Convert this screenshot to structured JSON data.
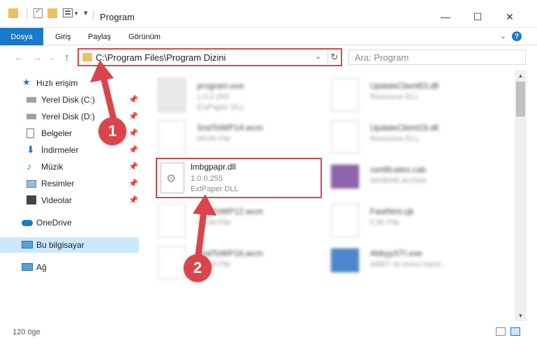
{
  "window": {
    "title": "Program",
    "minimize_glyph": "—",
    "maximize_glyph": "☐",
    "close_glyph": "✕"
  },
  "ribbon": {
    "tabs": [
      "Dosya",
      "Giriş",
      "Paylaş",
      "Görünüm"
    ],
    "expand_glyph": "⌄",
    "help_glyph": "?"
  },
  "address": {
    "path": "C:\\Program Files\\Program Dizini",
    "dropdown_glyph": "⌄",
    "refresh_glyph": "↻"
  },
  "search": {
    "placeholder": "Ara: Program"
  },
  "nav": {
    "back_glyph": "←",
    "forward_glyph": "→",
    "recent_glyph": "⌄",
    "up_glyph": "↑",
    "items": [
      {
        "label": "Hızlı erişim",
        "icon": "star-icon"
      },
      {
        "label": "Yerel Disk (C:)",
        "icon": "drive-icon",
        "pinned": true
      },
      {
        "label": "Yerel Disk (D:)",
        "icon": "drive-icon",
        "pinned": true
      },
      {
        "label": "Belgeler",
        "icon": "documents-icon",
        "pinned": true
      },
      {
        "label": "İndirmeler",
        "icon": "downloads-icon",
        "pinned": true
      },
      {
        "label": "Müzik",
        "icon": "music-icon",
        "pinned": true
      },
      {
        "label": "Resimler",
        "icon": "pictures-icon",
        "pinned": true
      },
      {
        "label": "Videolar",
        "icon": "videos-icon",
        "pinned": true
      },
      {
        "label": "OneDrive",
        "icon": "cloud-icon"
      },
      {
        "label": "Bu bilgisayar",
        "icon": "computer-icon",
        "selected": true
      },
      {
        "label": "Ağ",
        "icon": "network-icon"
      }
    ],
    "pin_glyph": "📌"
  },
  "files": [
    {
      "name": "program.exe",
      "line2": "1.0.0.255",
      "line3": "ExtPaper DLL",
      "icon": "exe-icon",
      "blurred": true
    },
    {
      "name": "UpdateClient63.dll",
      "line2": "Resource DLL",
      "line3": "",
      "icon": "dll-icon",
      "blurred": true
    },
    {
      "name": "SndToWP14.wcm",
      "line2": "WCM File",
      "line3": "",
      "icon": "file-icon",
      "blurred": true
    },
    {
      "name": "UpdateClient19.dll",
      "line2": "Resource DLL",
      "line3": "",
      "icon": "dll-icon",
      "blurred": true
    },
    {
      "name": "lmbgpapr.dll",
      "line2": "1.0.0.255",
      "line3": "ExtPaper DLL",
      "icon": "dll-icon",
      "blurred": false,
      "highlight": true
    },
    {
      "name": "certificates.cab",
      "line2": "WinRAR Archive",
      "line3": "",
      "icon": "archive-icon",
      "blurred": true
    },
    {
      "name": "SndToWP12.wcm",
      "line2": "WCM File",
      "line3": "",
      "icon": "file-icon",
      "blurred": true
    },
    {
      "name": "FastNml.cjk",
      "line2": "CJK File",
      "line3": "",
      "icon": "file-icon",
      "blurred": true
    },
    {
      "name": "SndToWP16.wcm",
      "line2": "WCM File",
      "line3": "",
      "icon": "file-icon",
      "blurred": true
    },
    {
      "name": "AbbyySTI.exe",
      "line2": "ABBY sti event hand...",
      "line3": "",
      "icon": "exe-icon",
      "blurred": true
    }
  ],
  "status": {
    "count": "120 öge"
  },
  "callouts": {
    "one": "1",
    "two": "2"
  },
  "colors": {
    "accent": "#1979ca",
    "highlight": "#d9454a",
    "selected_bg": "#cce8ff"
  }
}
